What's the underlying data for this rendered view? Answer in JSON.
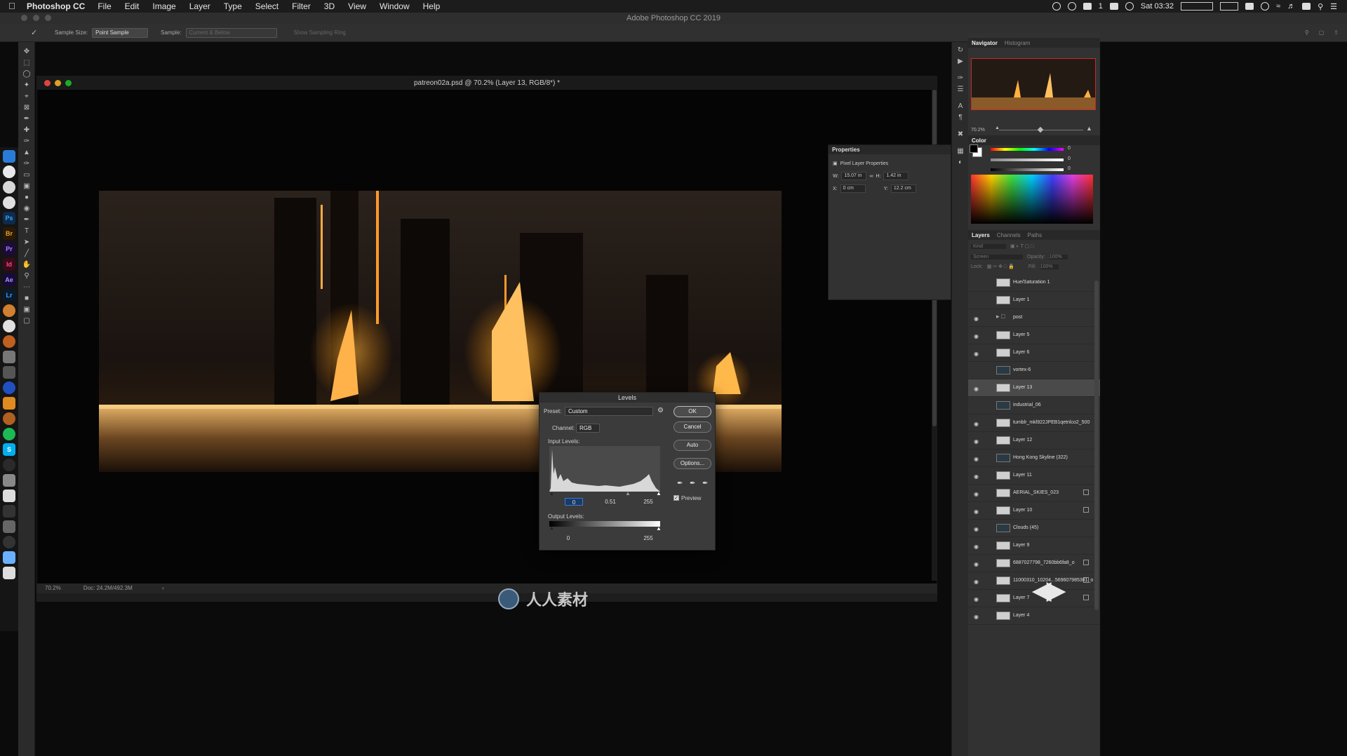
{
  "menubar": {
    "app": "Photoshop CC",
    "items": [
      "File",
      "Edit",
      "Image",
      "Layer",
      "Type",
      "Select",
      "Filter",
      "3D",
      "View",
      "Window",
      "Help"
    ],
    "clock": "Sat 03:32",
    "battery_count": "1"
  },
  "window_title": "Adobe Photoshop CC 2019",
  "options_bar": {
    "sample_size_label": "Sample Size:",
    "sample_size_value": "Point Sample",
    "sample_label": "Sample:",
    "sample_value": "Current & Below",
    "show_ring": "Show Sampling Ring"
  },
  "document": {
    "title": "patreon02a.psd @ 70.2% (Layer 13, RGB/8*) *",
    "zoom": "70.2%",
    "doc_size": "Doc: 24.2M/492.3M"
  },
  "properties": {
    "title": "Properties",
    "subtitle": "Pixel Layer Properties",
    "w_label": "W:",
    "w_value": "15.07 in",
    "h_label": "H:",
    "h_value": "1.42 in",
    "x_label": "X:",
    "x_value": "0 cm",
    "y_label": "Y:",
    "y_value": "12.2 cm"
  },
  "navigator": {
    "tabs": [
      "Navigator",
      "Histogram"
    ],
    "zoom": "70.2%"
  },
  "color_panel": {
    "title": "Color",
    "values": [
      "0",
      "0",
      "0"
    ],
    "accent_red": "#ff3030"
  },
  "layers_panel": {
    "tabs": [
      "Layers",
      "Channels",
      "Paths"
    ],
    "kind": "Kind",
    "blend": "Screen",
    "opacity_label": "Opacity:",
    "opacity_value": "100%",
    "lock_label": "Lock:",
    "fill_label": "Fill:",
    "fill_value": "100%",
    "layers": [
      {
        "name": "Hue/Saturation 1",
        "visible": false,
        "thumb": "adjust"
      },
      {
        "name": "Layer 1",
        "visible": false,
        "thumb": "light"
      },
      {
        "name": "post",
        "visible": true,
        "thumb": "folder"
      },
      {
        "name": "Layer 5",
        "visible": true,
        "thumb": "light"
      },
      {
        "name": "Layer 6",
        "visible": true,
        "thumb": "light"
      },
      {
        "name": "vortex-6",
        "visible": false,
        "thumb": "dark"
      },
      {
        "name": "Layer 13",
        "visible": true,
        "thumb": "light",
        "selected": true
      },
      {
        "name": "industrial_06",
        "visible": false,
        "thumb": "dark"
      },
      {
        "name": "tumblr_mkl922JPEB1qetnlco2_500",
        "visible": true,
        "thumb": "light"
      },
      {
        "name": "Layer 12",
        "visible": true,
        "thumb": "light"
      },
      {
        "name": "Hong Kong Skyline (322)",
        "visible": true,
        "thumb": "dark"
      },
      {
        "name": "Layer 11",
        "visible": true,
        "thumb": "light"
      },
      {
        "name": "AERIAL_SKIES_023",
        "visible": true,
        "thumb": "light",
        "fx": true
      },
      {
        "name": "Layer 10",
        "visible": true,
        "thumb": "light",
        "fx": true
      },
      {
        "name": "Clouds (45)",
        "visible": true,
        "thumb": "dark"
      },
      {
        "name": "Layer 9",
        "visible": true,
        "thumb": "light"
      },
      {
        "name": "6887027798_7260bb6fa8_o",
        "visible": true,
        "thumb": "light",
        "fx": true
      },
      {
        "name": "11000310_10204...569607985381_o",
        "visible": true,
        "thumb": "light",
        "fx": true
      },
      {
        "name": "Layer 7",
        "visible": true,
        "thumb": "light",
        "fx": true
      },
      {
        "name": "Layer 4",
        "visible": true,
        "thumb": "light"
      }
    ]
  },
  "levels_dialog": {
    "title": "Levels",
    "preset_label": "Preset:",
    "preset_value": "Custom",
    "channel_label": "Channel:",
    "channel_value": "RGB",
    "input_label": "Input Levels:",
    "input_black": "0",
    "input_gamma": "0.51",
    "input_white": "255",
    "output_label": "Output Levels:",
    "output_black": "0",
    "output_white": "255",
    "buttons": {
      "ok": "OK",
      "cancel": "Cancel",
      "auto": "Auto",
      "options": "Options..."
    },
    "preview_label": "Preview",
    "preview_checked": true
  },
  "watermarks": {
    "rrcg": "RRCG",
    "cn": "人人素材"
  }
}
